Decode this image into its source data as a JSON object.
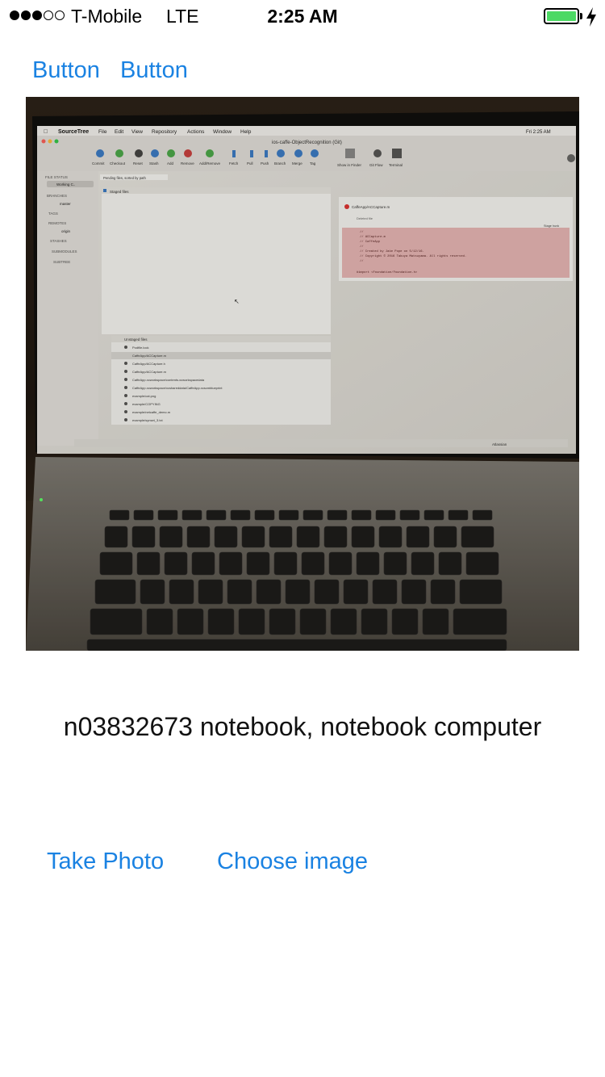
{
  "status_bar": {
    "signal_strength": 3,
    "signal_max": 5,
    "carrier": "T-Mobile",
    "network": "LTE",
    "time": "2:25 AM",
    "battery_level": 1.0,
    "battery_color": "#4cd964",
    "charging": true
  },
  "nav": {
    "button_1": "Button",
    "button_2": "Button"
  },
  "photo": {
    "description_icon": "photo-of-laptop-running-sourcetree",
    "screen": {
      "app_name": "SourceTree",
      "menu": [
        "File",
        "Edit",
        "View",
        "Repository",
        "Actions",
        "Window",
        "Help"
      ],
      "repo_title": "ios-caffe-ObjectRecognition (Git)",
      "clock": "Fri 2:25 AM",
      "toolbar": [
        "Commit",
        "Checkout",
        "Reset",
        "Stash",
        "Add",
        "Remove",
        "Add/Remove",
        "Fetch",
        "Pull",
        "Push",
        "Branch",
        "Merge",
        "Tag"
      ],
      "toolbar_right": [
        "Show in Finder",
        "Git Flow",
        "Terminal"
      ],
      "sidebar": {
        "file_status": "FILE STATUS",
        "working_copy": "Working C..",
        "branches": "BRANCHES",
        "master": "master",
        "tags": "TAGS",
        "remotes": "REMOTES",
        "origin": "origin",
        "stashes": "STASHES",
        "submodules": "SUBMODULES",
        "subtree": "SUBTREE"
      },
      "filter": "Pending files, sorted by path",
      "staged_label": "Staged files",
      "unstaged_label": "Unstaged files",
      "unstaged_files": [
        "Podfile.lock",
        "CaffeApp/ACCapture.m",
        "CaffeApp/ACCapture.h",
        "CaffeApp/ACCapture.m",
        "CaffeApp.xcworkspace/contents.xcworkspacedata",
        "CaffeApp.xcworkspace/xcshareddata/CaffeApp.xcscmblueprint",
        "example/cat.png",
        "example/COPYING",
        "example/netcaffe_demo.m",
        "example/synset_3.txt"
      ],
      "diff_file": "CaffeApp/ACCapture.m",
      "diff_status": "Deleted file",
      "diff_button": "Stage hunk",
      "diff_lines": [
        "//",
        "//  ACCapture.m",
        "//  CaffeApp",
        "//",
        "//  Created by Jake Pope on 5/12/16.",
        "//  Copyright © 2016 Takuya Matsuyama. All rights reserved.",
        "//",
        "",
        "#import <Foundation/Foundation.h>"
      ],
      "footer_brand": "Atlassian"
    }
  },
  "result": {
    "label": "n03832673 notebook, notebook computer"
  },
  "actions": {
    "take_photo": "Take Photo",
    "choose_image": "Choose image"
  },
  "colors": {
    "accent": "#1a82e2",
    "battery": "#4cd964"
  }
}
